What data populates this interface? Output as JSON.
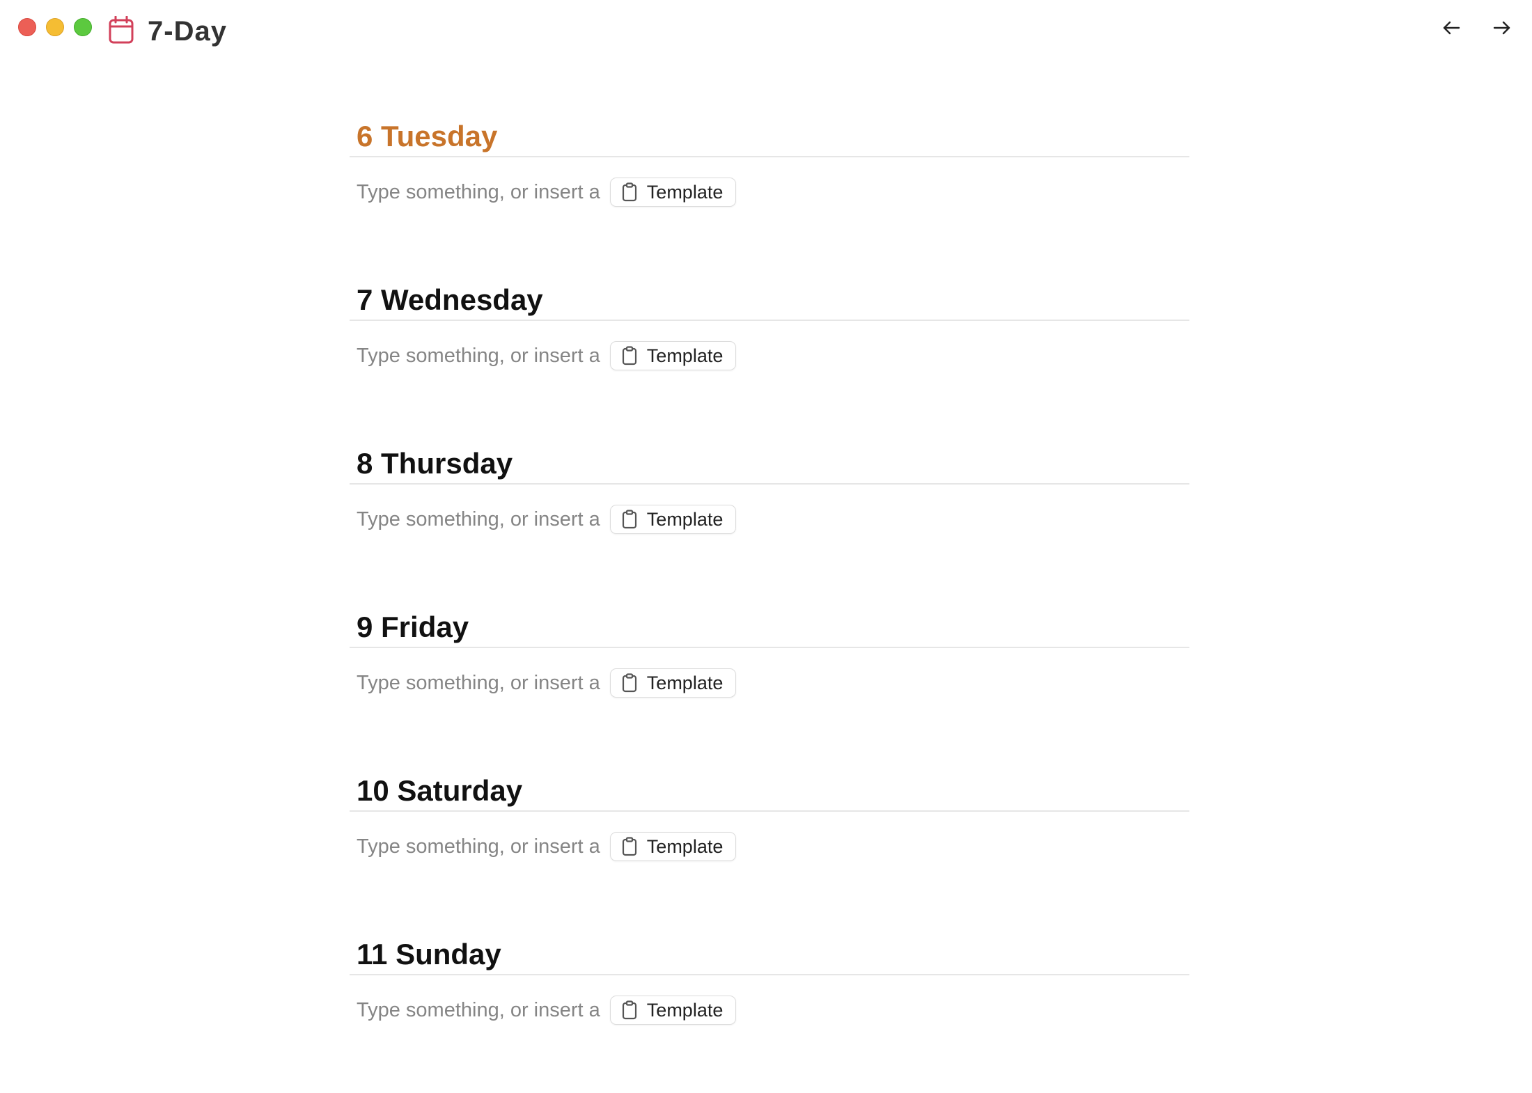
{
  "window": {
    "title": "7-Day",
    "icon": "calendar-icon",
    "accent_color": "#d2405a"
  },
  "navigation": {
    "back_icon": "arrow-left-icon",
    "forward_icon": "arrow-right-icon"
  },
  "days": [
    {
      "label": "6 Tuesday",
      "is_today": true,
      "placeholder": "Type something, or insert a",
      "template_label": "Template"
    },
    {
      "label": "7 Wednesday",
      "is_today": false,
      "placeholder": "Type something, or insert a",
      "template_label": "Template"
    },
    {
      "label": "8 Thursday",
      "is_today": false,
      "placeholder": "Type something, or insert a",
      "template_label": "Template"
    },
    {
      "label": "9 Friday",
      "is_today": false,
      "placeholder": "Type something, or insert a",
      "template_label": "Template"
    },
    {
      "label": "10 Saturday",
      "is_today": false,
      "placeholder": "Type something, or insert a",
      "template_label": "Template"
    },
    {
      "label": "11 Sunday",
      "is_today": false,
      "placeholder": "Type something, or insert a",
      "template_label": "Template"
    }
  ],
  "colors": {
    "today_heading": "#c8742a",
    "heading": "#111111",
    "placeholder": "#858585"
  }
}
